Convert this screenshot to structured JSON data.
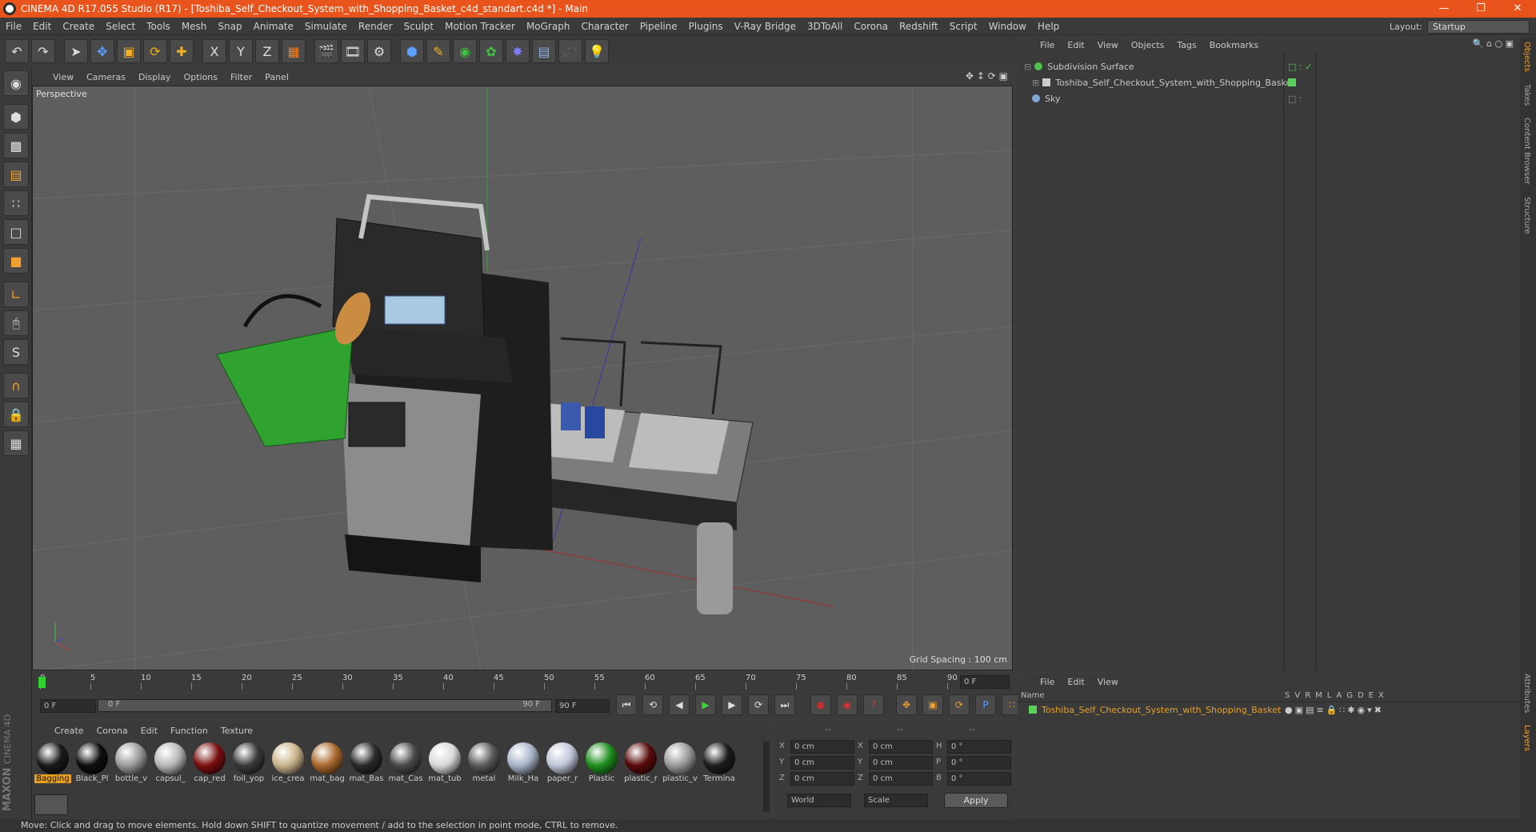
{
  "title": "CINEMA 4D R17.055 Studio (R17) - [Toshiba_Self_Checkout_System_with_Shopping_Basket_c4d_standart.c4d *] - Main",
  "menu": [
    "File",
    "Edit",
    "Create",
    "Select",
    "Tools",
    "Mesh",
    "Snap",
    "Animate",
    "Simulate",
    "Render",
    "Sculpt",
    "Motion Tracker",
    "MoGraph",
    "Character",
    "Pipeline",
    "Plugins",
    "V-Ray Bridge",
    "3DToAll",
    "Corona",
    "Redshift",
    "Script",
    "Window",
    "Help"
  ],
  "layout": {
    "label": "Layout:",
    "value": "Startup"
  },
  "viewport": {
    "menu": [
      "View",
      "Cameras",
      "Display",
      "Options",
      "Filter",
      "Panel"
    ],
    "camera_label": "Perspective",
    "grid_spacing": "Grid Spacing : 100 cm"
  },
  "timeline": {
    "ticks": [
      "0",
      "5",
      "10",
      "15",
      "20",
      "25",
      "30",
      "35",
      "40",
      "45",
      "50",
      "55",
      "60",
      "65",
      "70",
      "75",
      "80",
      "85",
      "90"
    ],
    "current_frame": "0 F",
    "start_field": "0 F",
    "range_start": "0 F",
    "range_end": "90 F",
    "end_field": "90 F"
  },
  "materials": {
    "menu": [
      "Create",
      "Corona",
      "Edit",
      "Function",
      "Texture"
    ],
    "items": [
      {
        "label": "Bagging",
        "color": "#1a1a1a",
        "selected": true
      },
      {
        "label": "Black_Pl",
        "color": "#0e0e0e"
      },
      {
        "label": "bottle_v",
        "color": "#9a9a9a"
      },
      {
        "label": "capsul_",
        "color": "#b8b8b8"
      },
      {
        "label": "cap_red",
        "color": "#7a0f0f"
      },
      {
        "label": "foil_yop",
        "color": "#3a3a3a"
      },
      {
        "label": "ice_crea",
        "color": "#c9b48a"
      },
      {
        "label": "mat_bag",
        "color": "#a9682c"
      },
      {
        "label": "mat_Bas",
        "color": "#2a2a2a"
      },
      {
        "label": "mat_Cas",
        "color": "#4a4a4a"
      },
      {
        "label": "mat_tub",
        "color": "#d8d8d8"
      },
      {
        "label": "metal",
        "color": "#5a5a5a"
      },
      {
        "label": "Milk_Ha",
        "color": "#a8b4c8"
      },
      {
        "label": "paper_r",
        "color": "#c0c6d8"
      },
      {
        "label": "Plastic",
        "color": "#1f8f1f"
      },
      {
        "label": "plastic_r",
        "color": "#5a0b0b"
      },
      {
        "label": "plastic_v",
        "color": "#9a9a9a"
      },
      {
        "label": "Termina",
        "color": "#1c1c1c"
      }
    ]
  },
  "coords": {
    "headers": [
      "--",
      "--",
      "--"
    ],
    "rows": [
      {
        "a": "X",
        "av": "0 cm",
        "b": "X",
        "bv": "0 cm",
        "c": "H",
        "cv": "0 °"
      },
      {
        "a": "Y",
        "av": "0 cm",
        "b": "Y",
        "bv": "0 cm",
        "c": "P",
        "cv": "0 °"
      },
      {
        "a": "Z",
        "av": "0 cm",
        "b": "Z",
        "bv": "0 cm",
        "c": "B",
        "cv": "0 °"
      }
    ],
    "world": "World",
    "scale": "Scale",
    "apply": "Apply"
  },
  "objects": {
    "menu": [
      "File",
      "Edit",
      "View",
      "Objects",
      "Tags",
      "Bookmarks"
    ],
    "items": [
      {
        "name": "Subdivision Surface",
        "color": "#4fbf4f"
      },
      {
        "name": "Toshiba_Self_Checkout_System_with_Shopping_Basket",
        "color": "#dddddd"
      },
      {
        "name": "Sky",
        "color": "#7fa6d6"
      }
    ]
  },
  "layers": {
    "menu": [
      "File",
      "Edit",
      "View"
    ],
    "name_header": "Name",
    "flags": [
      "S",
      "V",
      "R",
      "M",
      "L",
      "A",
      "G",
      "D",
      "E",
      "X"
    ],
    "item": "Toshiba_Self_Checkout_System_with_Shopping_Basket",
    "item_color": "#e8a020"
  },
  "right_tabs": [
    "Objects",
    "Takes",
    "Content Browser",
    "Structure"
  ],
  "right_tabs_bottom": [
    "Attributes",
    "Layers"
  ],
  "brand": {
    "line1": "MAXON",
    "line2": "CINEMA 4D"
  },
  "status": "Move: Click and drag to move elements. Hold down SHIFT to quantize movement / add to the selection in point mode, CTRL to remove."
}
